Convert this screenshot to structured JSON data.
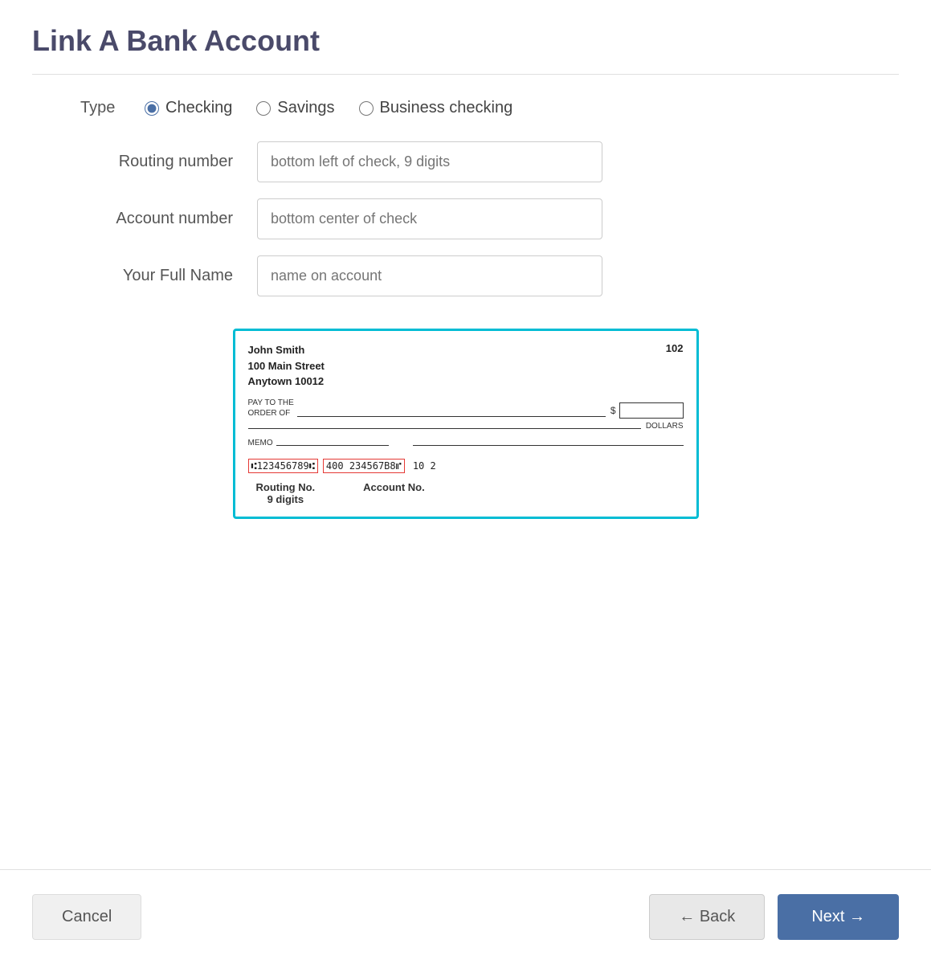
{
  "page": {
    "title": "Link A Bank Account"
  },
  "type_row": {
    "label": "Type",
    "options": [
      {
        "id": "checking",
        "label": "Checking",
        "checked": true
      },
      {
        "id": "savings",
        "label": "Savings",
        "checked": false
      },
      {
        "id": "business_checking",
        "label": "Business checking",
        "checked": false
      }
    ]
  },
  "fields": [
    {
      "id": "routing_number",
      "label": "Routing number",
      "placeholder": "bottom left of check, 9 digits"
    },
    {
      "id": "account_number",
      "label": "Account number",
      "placeholder": "bottom center of check"
    },
    {
      "id": "full_name",
      "label": "Your Full Name",
      "placeholder": "name on account"
    }
  ],
  "check": {
    "owner_name": "John Smith",
    "address_line1": "100 Main Street",
    "address_line2": "Anytown 10012",
    "check_number": "102",
    "pay_to_label": "PAY TO THE\nORDER OF",
    "dollars_label": "DOLLARS",
    "memo_label": "MEMO",
    "dollar_sign": "$",
    "micr_routing": "⑆123456789⑆",
    "micr_account": "400234567B8⑈",
    "micr_check": "102",
    "routing_label": "Routing No.\n9 digits",
    "account_label": "Account No."
  },
  "buttons": {
    "cancel": "Cancel",
    "back": "← Back",
    "next": "Next →"
  }
}
